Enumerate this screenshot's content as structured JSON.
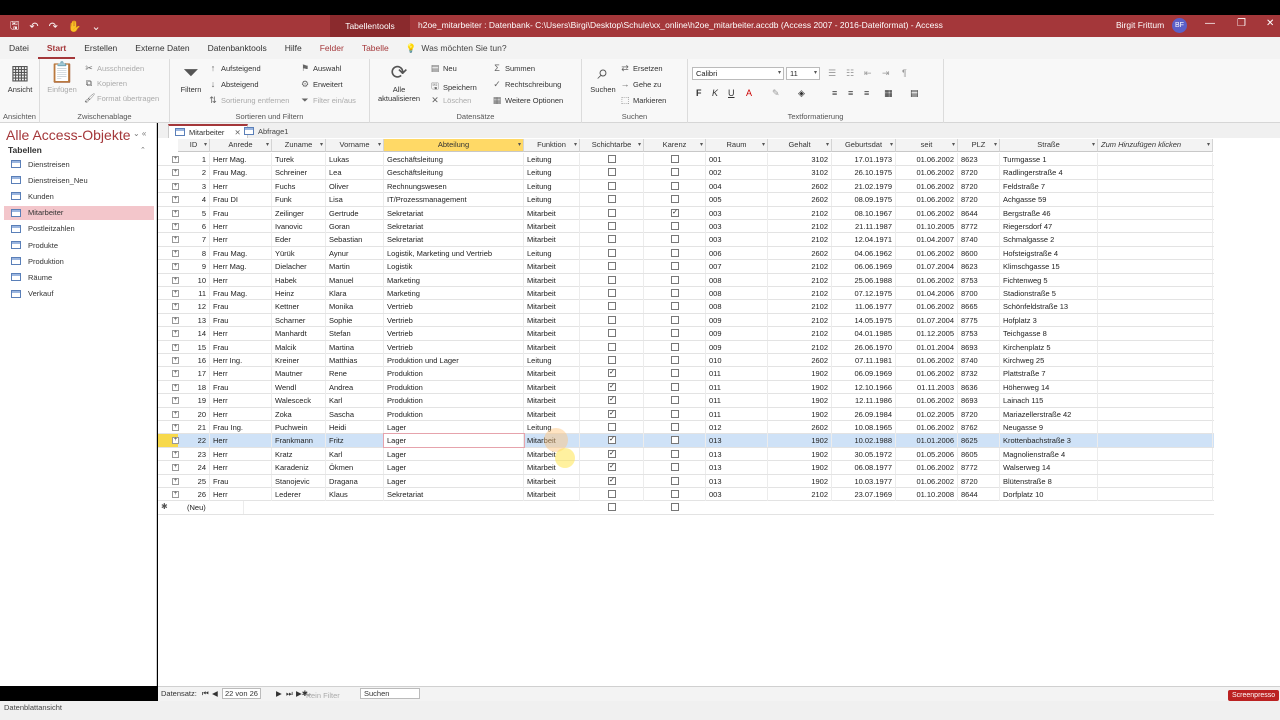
{
  "titlebar": {
    "context_tab": "Tabellentools",
    "title": "h2oe_mitarbeiter : Datenbank- C:\\Users\\Birgi\\Desktop\\Schule\\xx_online\\h2oe_mitarbeiter.accdb (Access 2007 - 2016-Dateiformat) - Access",
    "user": "Birgit Frittum",
    "avatar": "BF",
    "minimize": "—",
    "restore": "❐",
    "close": "✕"
  },
  "ribbon_tabs": [
    "Datei",
    "Start",
    "Erstellen",
    "Externe Daten",
    "Datenbanktools",
    "Hilfe",
    "Felder",
    "Tabelle"
  ],
  "tell_me": "Was möchten Sie tun?",
  "ribbon": {
    "ansicht": "Ansicht",
    "ansichten_label": "Ansichten",
    "einfuegen": "Einfügen",
    "ausschneiden": "Ausschneiden",
    "kopieren": "Kopieren",
    "format_uebertragen": "Format übertragen",
    "zwischenablage_label": "Zwischenablage",
    "filtern": "Filtern",
    "aufsteigend": "Aufsteigend",
    "absteigend": "Absteigend",
    "sortierung_entfernen": "Sortierung entfernen",
    "auswahl": "Auswahl",
    "erweitert": "Erweitert",
    "filter_ein_aus": "Filter ein/aus",
    "sortieren_label": "Sortieren und Filtern",
    "alle_aktualisieren": "Alle aktualisieren",
    "neu": "Neu",
    "speichern": "Speichern",
    "loeschen": "Löschen",
    "summen": "Summen",
    "rechtschreibung": "Rechtschreibung",
    "weitere_optionen": "Weitere Optionen",
    "datensaetze_label": "Datensätze",
    "suchen": "Suchen",
    "ersetzen": "Ersetzen",
    "gehe_zu": "Gehe zu",
    "markieren": "Markieren",
    "suchen_label": "Suchen",
    "font_name": "Calibri",
    "font_size": "11",
    "textformatierung_label": "Textformatierung"
  },
  "nav": {
    "title": "Alle Access-Objekte",
    "section": "Tabellen",
    "items": [
      "Dienstreisen",
      "Dienstreisen_Neu",
      "Kunden",
      "Mitarbeiter",
      "Postleitzahlen",
      "Produkte",
      "Produktion",
      "Räume",
      "Verkauf"
    ],
    "selected_index": 3
  },
  "doc_tabs": [
    "Mitarbeiter",
    "Abfrage1"
  ],
  "columns": [
    "ID",
    "Anrede",
    "Zuname",
    "Vorname",
    "Abteilung",
    "Funktion",
    "Schichtarbe",
    "Karenz",
    "Raum",
    "Gehalt",
    "Geburtsdat",
    "seit",
    "PLZ",
    "Straße",
    "Zum Hinzufügen klicken"
  ],
  "rows": [
    [
      "1",
      "Herr Mag.",
      "Turek",
      "Lukas",
      "Geschäftsleitung",
      "Leitung",
      false,
      false,
      "001",
      "3102",
      "17.01.1973",
      "01.06.2002",
      "8623",
      "Turmgasse 1"
    ],
    [
      "2",
      "Frau Mag.",
      "Schreiner",
      "Lea",
      "Geschäftsleitung",
      "Leitung",
      false,
      false,
      "002",
      "3102",
      "26.10.1975",
      "01.06.2002",
      "8720",
      "Radlingerstraße 4"
    ],
    [
      "3",
      "Herr",
      "Fuchs",
      "Oliver",
      "Rechnungswesen",
      "Leitung",
      false,
      false,
      "004",
      "2602",
      "21.02.1979",
      "01.06.2002",
      "8720",
      "Feldstraße 7"
    ],
    [
      "4",
      "Frau DI",
      "Funk",
      "Lisa",
      "IT/Prozessmanagement",
      "Leitung",
      false,
      false,
      "005",
      "2602",
      "08.09.1975",
      "01.06.2002",
      "8720",
      "Achgasse 59"
    ],
    [
      "5",
      "Frau",
      "Zeilinger",
      "Gertrude",
      "Sekretariat",
      "Mitarbeit",
      false,
      true,
      "003",
      "2102",
      "08.10.1967",
      "01.06.2002",
      "8644",
      "Bergstraße 46"
    ],
    [
      "6",
      "Herr",
      "Ivanovic",
      "Goran",
      "Sekretariat",
      "Mitarbeit",
      false,
      false,
      "003",
      "2102",
      "21.11.1987",
      "01.10.2005",
      "8772",
      "Riegersdorf 47"
    ],
    [
      "7",
      "Herr",
      "Eder",
      "Sebastian",
      "Sekretariat",
      "Mitarbeit",
      false,
      false,
      "003",
      "2102",
      "12.04.1971",
      "01.04.2007",
      "8740",
      "Schmalgasse 2"
    ],
    [
      "8",
      "Frau Mag.",
      "Yürük",
      "Aynur",
      "Logistik, Marketing und Vertrieb",
      "Leitung",
      false,
      false,
      "006",
      "2602",
      "04.06.1962",
      "01.06.2002",
      "8600",
      "Hofsteigstraße 4"
    ],
    [
      "9",
      "Herr Mag.",
      "Dielacher",
      "Martin",
      "Logistik",
      "Mitarbeit",
      false,
      false,
      "007",
      "2102",
      "06.06.1969",
      "01.07.2004",
      "8623",
      "Klimschgasse 15"
    ],
    [
      "10",
      "Herr",
      "Habek",
      "Manuel",
      "Marketing",
      "Mitarbeit",
      false,
      false,
      "008",
      "2102",
      "25.06.1988",
      "01.06.2002",
      "8753",
      "Fichtenweg 5"
    ],
    [
      "11",
      "Frau Mag.",
      "Heinz",
      "Klara",
      "Marketing",
      "Mitarbeit",
      false,
      false,
      "008",
      "2102",
      "07.12.1975",
      "01.04.2006",
      "8700",
      "Stadionstraße 5"
    ],
    [
      "12",
      "Frau",
      "Kettner",
      "Monika",
      "Vertrieb",
      "Mitarbeit",
      false,
      false,
      "008",
      "2102",
      "11.06.1977",
      "01.06.2002",
      "8665",
      "Schönfeldstraße 13"
    ],
    [
      "13",
      "Frau",
      "Scharner",
      "Sophie",
      "Vertrieb",
      "Mitarbeit",
      false,
      false,
      "009",
      "2102",
      "14.05.1975",
      "01.07.2004",
      "8775",
      "Hofplatz 3"
    ],
    [
      "14",
      "Herr",
      "Manhardt",
      "Stefan",
      "Vertrieb",
      "Mitarbeit",
      false,
      false,
      "009",
      "2102",
      "04.01.1985",
      "01.12.2005",
      "8753",
      "Teichgasse 8"
    ],
    [
      "15",
      "Frau",
      "Malcik",
      "Martina",
      "Vertrieb",
      "Mitarbeit",
      false,
      false,
      "009",
      "2102",
      "26.06.1970",
      "01.01.2004",
      "8693",
      "Kirchenplatz 5"
    ],
    [
      "16",
      "Herr Ing.",
      "Kreiner",
      "Matthias",
      "Produktion und Lager",
      "Leitung",
      false,
      false,
      "010",
      "2602",
      "07.11.1981",
      "01.06.2002",
      "8740",
      "Kirchweg 25"
    ],
    [
      "17",
      "Herr",
      "Mautner",
      "Rene",
      "Produktion",
      "Mitarbeit",
      true,
      false,
      "011",
      "1902",
      "06.09.1969",
      "01.06.2002",
      "8732",
      "Plattstraße 7"
    ],
    [
      "18",
      "Frau",
      "Wendl",
      "Andrea",
      "Produktion",
      "Mitarbeit",
      true,
      false,
      "011",
      "1902",
      "12.10.1966",
      "01.11.2003",
      "8636",
      "Höhenweg 14"
    ],
    [
      "19",
      "Herr",
      "Walesceck",
      "Karl",
      "Produktion",
      "Mitarbeit",
      true,
      false,
      "011",
      "1902",
      "12.11.1986",
      "01.06.2002",
      "8693",
      "Lainach 115"
    ],
    [
      "20",
      "Herr",
      "Zoka",
      "Sascha",
      "Produktion",
      "Mitarbeit",
      true,
      false,
      "011",
      "1902",
      "26.09.1984",
      "01.02.2005",
      "8720",
      "Mariazellerstraße 42"
    ],
    [
      "21",
      "Frau Ing.",
      "Puchwein",
      "Heidi",
      "Lager",
      "Leitung",
      false,
      false,
      "012",
      "2602",
      "10.08.1965",
      "01.06.2002",
      "8762",
      "Neugasse 9"
    ],
    [
      "22",
      "Herr",
      "Frankmann",
      "Fritz",
      "Lager",
      "Mitarbeit",
      true,
      false,
      "013",
      "1902",
      "10.02.1988",
      "01.01.2006",
      "8625",
      "Krottenbachstraße 3"
    ],
    [
      "23",
      "Herr",
      "Kratz",
      "Karl",
      "Lager",
      "Mitarbeit",
      true,
      false,
      "013",
      "1902",
      "30.05.1972",
      "01.05.2006",
      "8605",
      "Magnolienstraße 4"
    ],
    [
      "24",
      "Herr",
      "Karadeniz",
      "Ökmen",
      "Lager",
      "Mitarbeit",
      true,
      false,
      "013",
      "1902",
      "06.08.1977",
      "01.06.2002",
      "8772",
      "Walserweg 14"
    ],
    [
      "25",
      "Frau",
      "Stanojevic",
      "Dragana",
      "Lager",
      "Mitarbeit",
      true,
      false,
      "013",
      "1902",
      "10.03.1977",
      "01.06.2002",
      "8720",
      "Blütenstraße 8"
    ],
    [
      "26",
      "Herr",
      "Lederer",
      "Klaus",
      "Sekretariat",
      "Mitarbeit",
      false,
      false,
      "003",
      "2102",
      "23.07.1969",
      "01.10.2008",
      "8644",
      "Dorfplatz 10"
    ]
  ],
  "new_row_label": "(Neu)",
  "selected_row": 21,
  "recnav": {
    "label": "Datensatz:",
    "position": "22 von 26",
    "filter": "Kein Filter",
    "search": "Suchen"
  },
  "status": "Datenblattansicht",
  "watermark": "Screenpresso",
  "accent": "#a4373a"
}
